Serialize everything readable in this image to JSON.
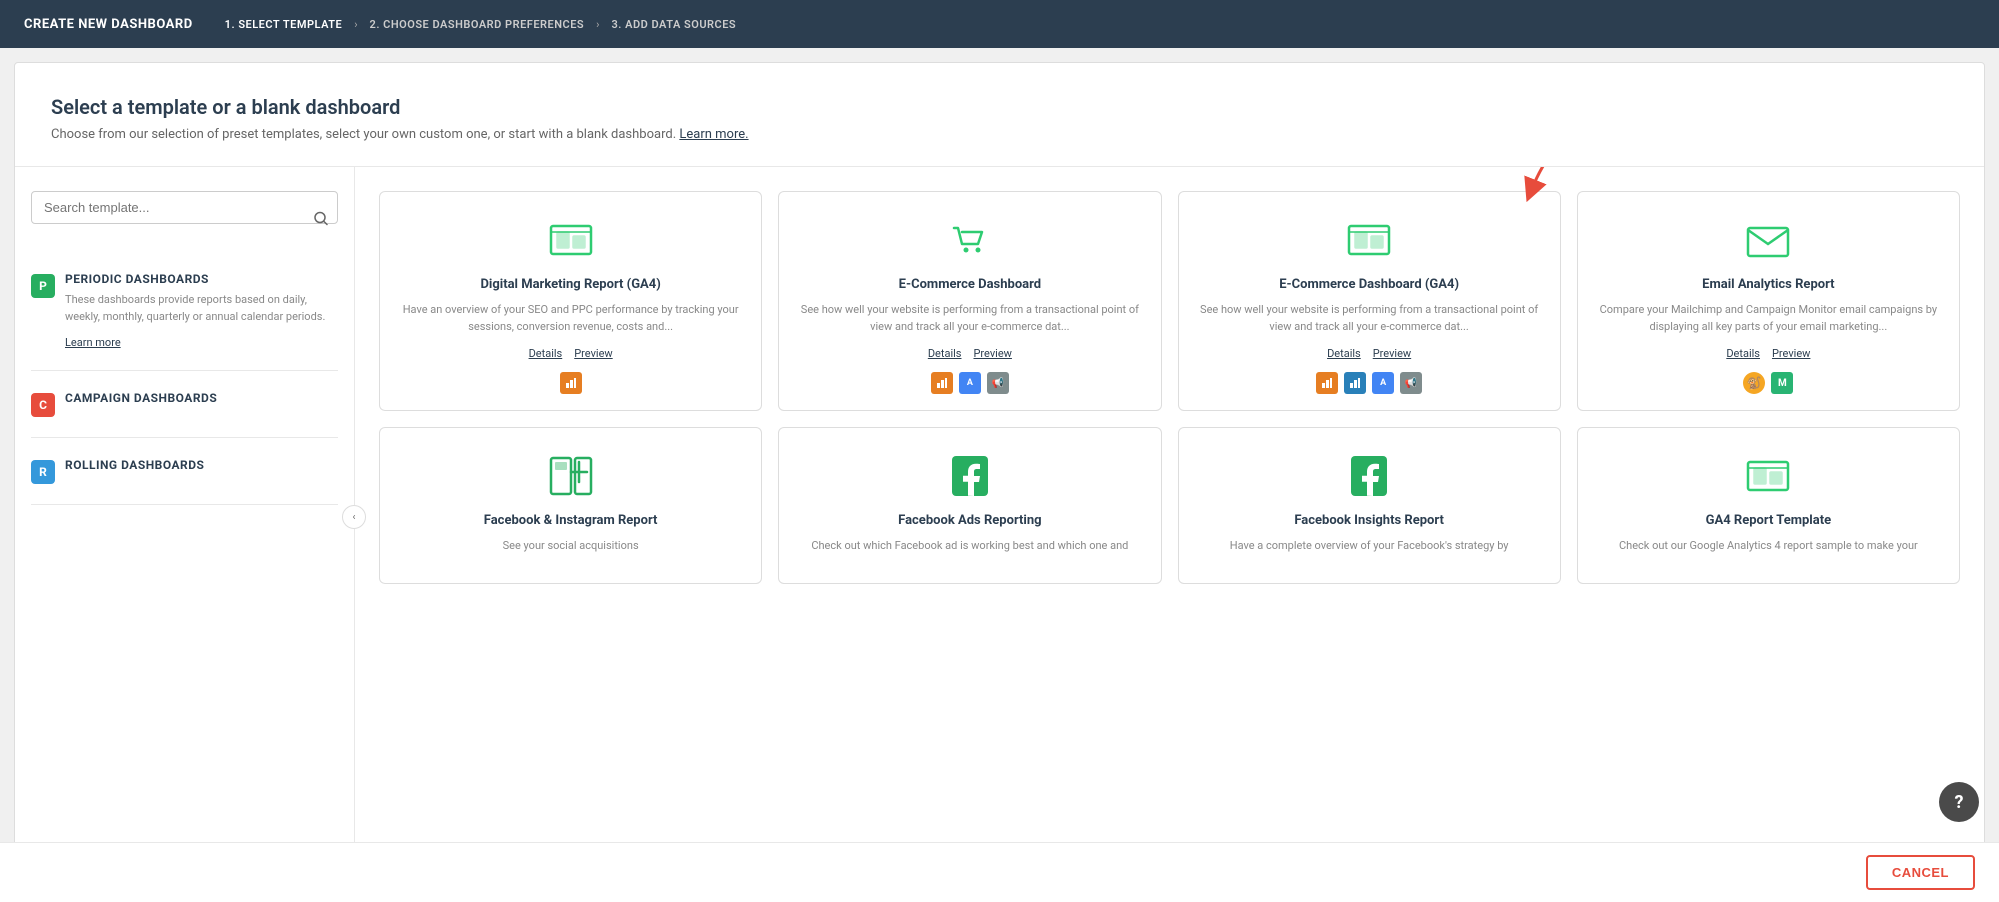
{
  "topBar": {
    "title": "CREATE NEW DASHBOARD",
    "steps": [
      {
        "label": "1. SELECT TEMPLATE",
        "active": true
      },
      {
        "label": "2. CHOOSE DASHBOARD PREFERENCES",
        "active": false
      },
      {
        "label": "3. ADD DATA SOURCES",
        "active": false
      }
    ]
  },
  "header": {
    "title": "Select a template or a blank dashboard",
    "subtitle": "Choose from our selection of preset templates, select your own custom one, or start with a blank dashboard.",
    "learnMoreLabel": "Learn more."
  },
  "sidebar": {
    "searchPlaceholder": "Search template...",
    "categories": [
      {
        "badge": "P",
        "badgeColor": "badge-green",
        "label": "PERIODIC DASHBOARDS",
        "desc": "These dashboards provide reports based on daily, weekly, monthly, quarterly or annual calendar periods.",
        "learnMoreLabel": "Learn more"
      },
      {
        "badge": "C",
        "badgeColor": "badge-red",
        "label": "CAMPAIGN DASHBOARDS",
        "desc": "",
        "learnMoreLabel": ""
      },
      {
        "badge": "R",
        "badgeColor": "badge-blue",
        "label": "ROLLING DASHBOARDS",
        "desc": "",
        "learnMoreLabel": ""
      }
    ]
  },
  "templates": [
    {
      "id": "digital-marketing-ga4",
      "name": "Digital Marketing Report (GA4)",
      "desc": "Have an overview of your SEO and PPC performance by tracking your sessions, conversion revenue, costs and...",
      "hasArrow": false,
      "detailsLabel": "Details",
      "previewLabel": "Preview",
      "logos": [
        "powerbi-orange"
      ]
    },
    {
      "id": "ecommerce-dashboard",
      "name": "E-Commerce Dashboard",
      "desc": "See how well your website is performing from a transactional point of view and track all your e-commerce dat...",
      "hasArrow": false,
      "detailsLabel": "Details",
      "previewLabel": "Preview",
      "logos": [
        "powerbi-orange",
        "google-ads",
        "megaphone"
      ]
    },
    {
      "id": "ecommerce-ga4",
      "name": "E-Commerce Dashboard (GA4)",
      "desc": "See how well your website is performing from a transactional point of view and track all your e-commerce dat...",
      "hasArrow": true,
      "detailsLabel": "Details",
      "previewLabel": "Preview",
      "logos": [
        "powerbi-orange",
        "powerbi-blue",
        "google-ads",
        "megaphone"
      ]
    },
    {
      "id": "email-analytics",
      "name": "Email Analytics Report",
      "desc": "Compare your Mailchimp and Campaign Monitor email campaigns by displaying all key parts of your email marketing...",
      "hasArrow": false,
      "detailsLabel": "Details",
      "previewLabel": "Preview",
      "logos": [
        "mailchimp",
        "campaign-monitor"
      ]
    },
    {
      "id": "facebook-instagram",
      "name": "Facebook & Instagram Report",
      "desc": "See your social acquisitions",
      "hasArrow": false,
      "detailsLabel": "",
      "previewLabel": "",
      "logos": []
    },
    {
      "id": "facebook-ads",
      "name": "Facebook Ads Reporting",
      "desc": "Check out which Facebook ad is working best and which one and",
      "hasArrow": false,
      "detailsLabel": "",
      "previewLabel": "",
      "logos": []
    },
    {
      "id": "facebook-insights",
      "name": "Facebook Insights Report",
      "desc": "Have a complete overview of your Facebook's strategy by",
      "hasArrow": false,
      "detailsLabel": "",
      "previewLabel": "",
      "logos": []
    },
    {
      "id": "ga4-report",
      "name": "GA4 Report Template",
      "desc": "Check out our Google Analytics 4 report sample to make your",
      "hasArrow": false,
      "detailsLabel": "",
      "previewLabel": "",
      "logos": []
    }
  ],
  "footer": {
    "cancelLabel": "CANCEL"
  },
  "help": {
    "label": "?"
  }
}
